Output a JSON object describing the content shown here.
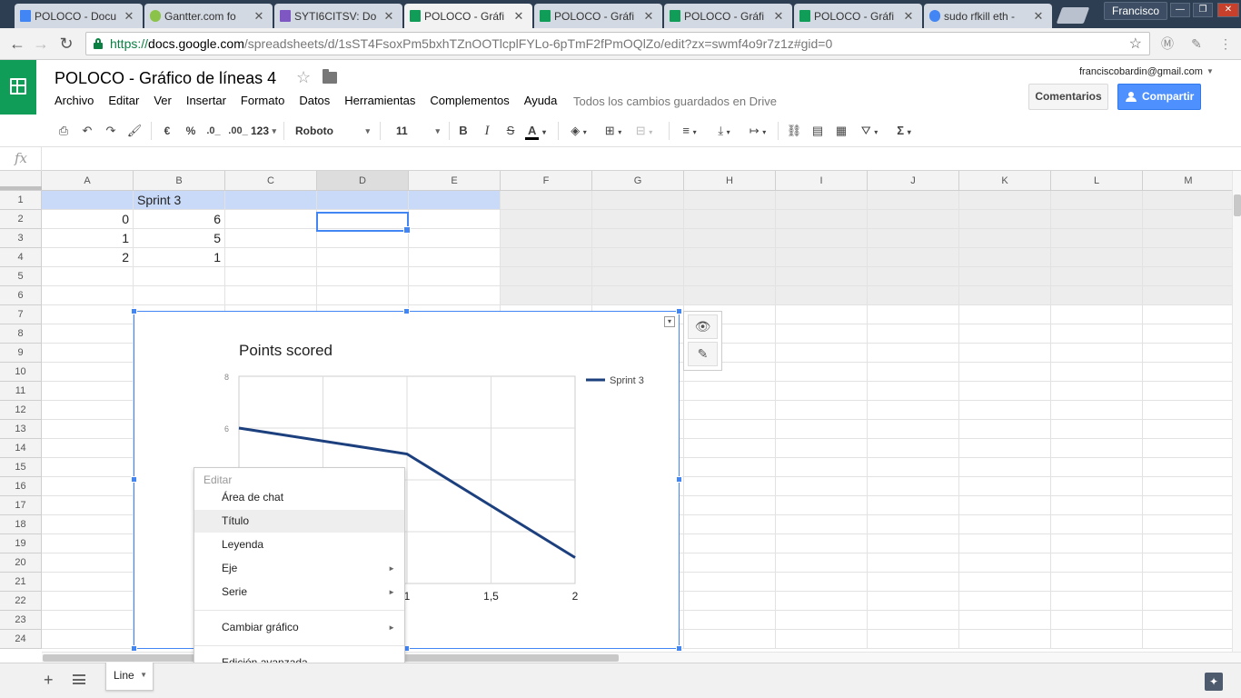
{
  "browser": {
    "tabs": [
      {
        "label": "POLOCO - Docu",
        "color": "#4285f4"
      },
      {
        "label": "Gantter.com fo",
        "color": "#8bc34a"
      },
      {
        "label": "SYTI6CITSV: Do",
        "color": "#7e57c2"
      },
      {
        "label": "POLOCO - Gráfi",
        "color": "#0f9d58"
      },
      {
        "label": "POLOCO - Gráfi",
        "color": "#0f9d58"
      },
      {
        "label": "POLOCO - Gráfi",
        "color": "#0f9d58"
      },
      {
        "label": "POLOCO - Gráfi",
        "color": "#0f9d58"
      },
      {
        "label": "sudo rfkill eth -",
        "color": "#4285f4"
      }
    ],
    "profile": "Francisco",
    "url": {
      "scheme": "https://",
      "host": "docs.google.com",
      "path": "/spreadsheets/d/1sST4FsoxPm5bxhTZnOOTlcplFYLo-6pTmF2fPmOQlZo/edit?zx=swmf4o9r7z1z#gid=0"
    }
  },
  "doc": {
    "title": "POLOCO - Gráfico de líneas 4",
    "menu": [
      "Archivo",
      "Editar",
      "Ver",
      "Insertar",
      "Formato",
      "Datos",
      "Herramientas",
      "Complementos",
      "Ayuda"
    ],
    "save_status": "Todos los cambios guardados en Drive",
    "user_email": "franciscobardin@gmail.com",
    "comments_label": "Comentarios",
    "share_label": "Compartir"
  },
  "toolbar": {
    "currency": "€",
    "percent": "%",
    "dec_less": ".0_",
    "dec_more": ".00_",
    "format_more": "123",
    "font": "Roboto",
    "font_size": "11",
    "bold": "B",
    "italic": "I",
    "strike": "S",
    "textcolor": "A",
    "sigma": "Σ"
  },
  "formula_bar": {
    "fx": "fx",
    "value": ""
  },
  "sheet": {
    "columns": [
      "A",
      "B",
      "C",
      "D",
      "E",
      "F",
      "G",
      "H",
      "I",
      "J",
      "K",
      "L",
      "M"
    ],
    "rows": [
      "1",
      "2",
      "3",
      "4",
      "5",
      "6",
      "7",
      "8",
      "9",
      "10",
      "11",
      "12",
      "13",
      "14",
      "15",
      "16",
      "17",
      "18",
      "19",
      "20",
      "21",
      "22",
      "23",
      "24"
    ],
    "b1": "Sprint 3",
    "data": [
      {
        "a": "0",
        "b": "6"
      },
      {
        "a": "1",
        "b": "5"
      },
      {
        "a": "2",
        "b": "1"
      }
    ],
    "tab_name": "Line"
  },
  "chart_data": {
    "type": "line",
    "title": "Points scored",
    "x": [
      0,
      1,
      2
    ],
    "series": [
      {
        "name": "Sprint 3",
        "values": [
          6,
          5,
          1
        ],
        "color": "#1c3f7e"
      }
    ],
    "ylim": [
      0,
      8
    ],
    "xlim": [
      0,
      2
    ],
    "y_ticks_visible": [
      "8",
      "6"
    ],
    "x_ticks_visible": [
      "1",
      "1,5",
      "2"
    ],
    "grid": true,
    "legend": "right"
  },
  "context_menu": {
    "header": "Editar",
    "items": [
      {
        "label": "Área de chat",
        "submenu": false
      },
      {
        "label": "Título",
        "submenu": false
      },
      {
        "label": "Leyenda",
        "submenu": false
      },
      {
        "label": "Eje",
        "submenu": true
      },
      {
        "label": "Serie",
        "submenu": true
      },
      {
        "label": "Cambiar gráfico",
        "submenu": true
      },
      {
        "label": "Edición avanzada...",
        "submenu": false
      }
    ]
  }
}
